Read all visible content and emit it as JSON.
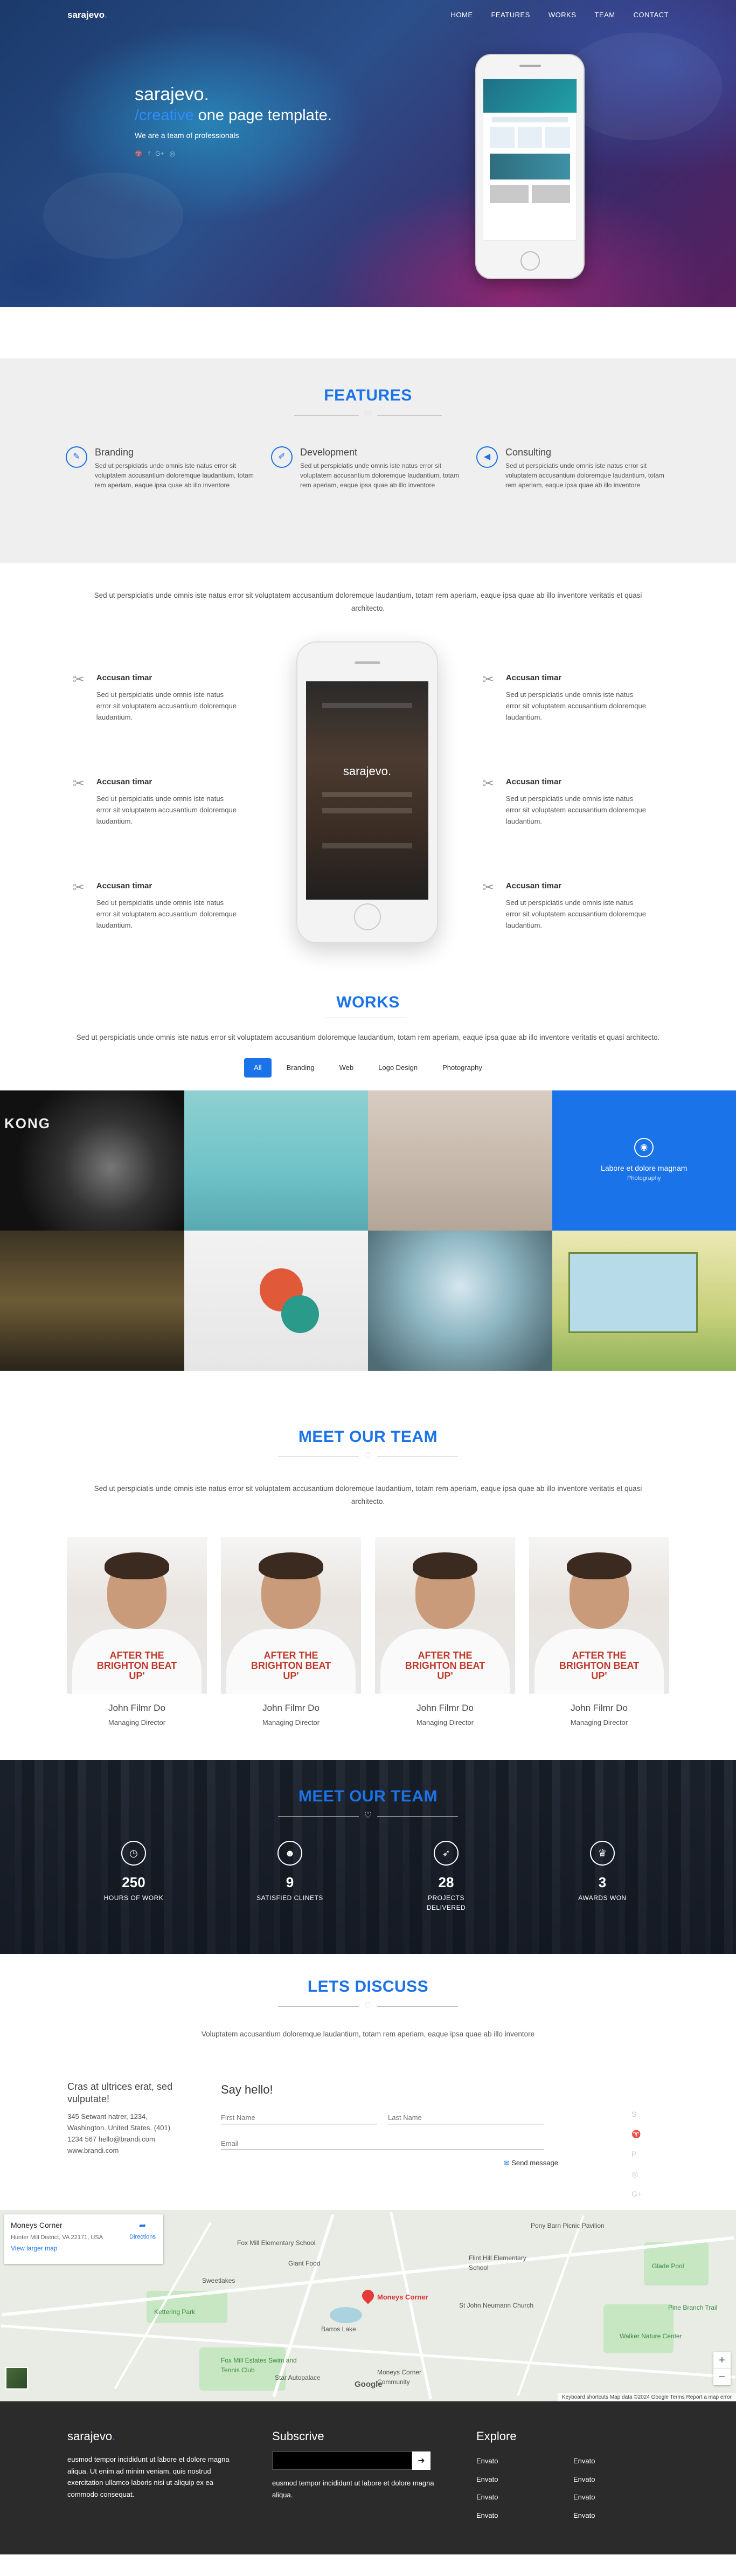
{
  "nav": {
    "logo": "sarajevo",
    "logo_dot": ".",
    "menu": [
      "HOME",
      "FEATURES",
      "WORKS",
      "TEAM",
      "CONTACT"
    ]
  },
  "hero": {
    "title": "sarajevo.",
    "subtitle_accent": "/creative",
    "subtitle_rest": " one page template.",
    "tagline": "We are a team of professionals",
    "social_icons": [
      "twitter-icon",
      "facebook-icon",
      "google-plus-icon",
      "dribbble-icon"
    ]
  },
  "features": {
    "title": "FEATURES",
    "items": [
      {
        "icon": "compass-icon",
        "glyph": "✎",
        "title": "Branding",
        "text": "Sed ut perspiciatis unde omnis iste natus error sit voluptatem accusantium doloremque laudantium, totam rem aperiam, eaque ipsa quae ab illo inventore"
      },
      {
        "icon": "pencil-icon",
        "glyph": "✐",
        "title": "Development",
        "text": "Sed ut perspiciatis unde omnis iste natus error sit voluptatem accusantium doloremque laudantium, totam rem aperiam, eaque ipsa quae ab illo inventore"
      },
      {
        "icon": "megaphone-icon",
        "glyph": "◀",
        "title": "Consulting",
        "text": "Sed ut perspiciatis unde omnis iste natus error sit voluptatem accusantium doloremque laudantium, totam rem aperiam, eaque ipsa quae ab illo inventore"
      }
    ]
  },
  "phone_features": {
    "lead": "Sed ut perspiciatis unde omnis iste natus error sit voluptatem accusantium doloremque laudantium, totam rem aperiam, eaque ipsa quae ab illo inventore veritatis et quasi architecto.",
    "phone_logo": "sarajevo.",
    "left": [
      {
        "title": "Accusan timar",
        "text": "Sed ut perspiciatis unde omnis iste natus error sit voluptatem accusantium doloremque laudantium."
      },
      {
        "title": "Accusan timar",
        "text": "Sed ut perspiciatis unde omnis iste natus error sit voluptatem accusantium doloremque laudantium."
      },
      {
        "title": "Accusan timar",
        "text": "Sed ut perspiciatis unde omnis iste natus error sit voluptatem accusantium doloremque laudantium."
      }
    ],
    "right": [
      {
        "title": "Accusan timar",
        "text": "Sed ut perspiciatis unde omnis iste natus error sit voluptatem accusantium doloremque laudantium."
      },
      {
        "title": "Accusan timar",
        "text": "Sed ut perspiciatis unde omnis iste natus error sit voluptatem accusantium doloremque laudantium."
      },
      {
        "title": "Accusan timar",
        "text": "Sed ut perspiciatis unde omnis iste natus error sit voluptatem accusantium doloremque laudantium."
      }
    ]
  },
  "works": {
    "title": "WORKS",
    "lead": "Sed ut perspiciatis unde omnis iste natus error sit voluptatem accusantium doloremque laudantium, totam rem aperiam, eaque ipsa quae ab illo inventore veritatis et quasi architecto.",
    "filters": [
      "All",
      "Branding",
      "Web",
      "Logo Design",
      "Photography"
    ],
    "active_filter": "All",
    "kong_text": "KONG",
    "hover_caption": "Labore et dolore magnam",
    "hover_sub": "Photography"
  },
  "team": {
    "title": "MEET OUR TEAM",
    "lead": "Sed ut perspiciatis unde omnis iste natus error sit voluptatem accusantium doloremque laudantium, totam rem aperiam, eaque ipsa quae ab illo inventore veritatis et quasi architecto.",
    "shirt_text": "AFTER THE BRIGHTON BEAT UP'",
    "members": [
      {
        "name": "John Filmr Do",
        "role": "Managing Director"
      },
      {
        "name": "John Filmr Do",
        "role": "Managing Director"
      },
      {
        "name": "John Filmr Do",
        "role": "Managing Director"
      },
      {
        "name": "John Filmr Do",
        "role": "Managing Director"
      }
    ]
  },
  "counter": {
    "title": "MEET OUR TEAM",
    "stats": [
      {
        "icon": "clock-icon",
        "glyph": "◷",
        "num": "250",
        "label": "HOURS OF WORK"
      },
      {
        "icon": "users-icon",
        "glyph": "☻",
        "num": "9",
        "label": "SATISFIED CLINETS"
      },
      {
        "icon": "rocket-icon",
        "glyph": "➶",
        "num": "28",
        "label": "PROJECTS DELIVERED"
      },
      {
        "icon": "trophy-icon",
        "glyph": "♛",
        "num": "3",
        "label": "AWARDS WON"
      }
    ]
  },
  "contact": {
    "title": "LETS DISCUSS",
    "lead": "Voluptatem accusantium doloremque laudantium, totam rem aperiam, eaque ipsa quae ab illo inventore",
    "address_title": "Cras at ultrices erat, sed vulputate!",
    "address_lines": [
      "345 Setwant natrer, 1234,",
      "Washington. United States.",
      "(401) 1234 567",
      "hello@brandi.com",
      "www.brandi.com"
    ],
    "form_title": "Say hello!",
    "first_name_placeholder": "First Name",
    "last_name_placeholder": "Last Name",
    "email_placeholder": "Email",
    "send_label": "Send message",
    "side_icons": [
      "skype-icon",
      "twitter-icon",
      "pinterest-icon",
      "dribbble-icon",
      "google-plus-icon"
    ]
  },
  "map": {
    "card_title": "Moneys Corner",
    "card_address": "Hunter Mill District, VA 22171, USA",
    "card_link": "View larger map",
    "directions": "Directions",
    "pin_label": "Moneys Corner",
    "labels": [
      "Fox Mill Elementary School",
      "Giant Food",
      "Sweetlakes",
      "Kettering Park",
      "Fox Mill Estates Swim and Tennis Club",
      "Barros Lake",
      "Flint Hill Elementary School",
      "St John Neumann Church",
      "Glade Pool",
      "Walker Nature Center",
      "Pony Barn Picnic Pavilion",
      "Star Autopalace",
      "Moneys Corner Community",
      "Pine Branch Trail"
    ],
    "google": "Google",
    "footer_text": "Keyboard shortcuts   Map data ©2024 Google   Terms   Report a map error"
  },
  "footer": {
    "brand": "sarajevo",
    "brand_dot": ".",
    "brand_text": "eusmod tempor incididunt ut labore et dolore magna aliqua. Ut enim ad minim veniam, quis nostrud exercitation ullamco laboris nisi ut aliquip ex ea commodo consequat.",
    "subscribe_title": "Subscrive",
    "subscribe_text": "eusmod tempor incididunt ut labore et dolore magna aliqua.",
    "explore_title": "Explore",
    "links": [
      "Envato",
      "Envato",
      "Envato",
      "Envato",
      "Envato",
      "Envato",
      "Envato",
      "Envato"
    ]
  }
}
